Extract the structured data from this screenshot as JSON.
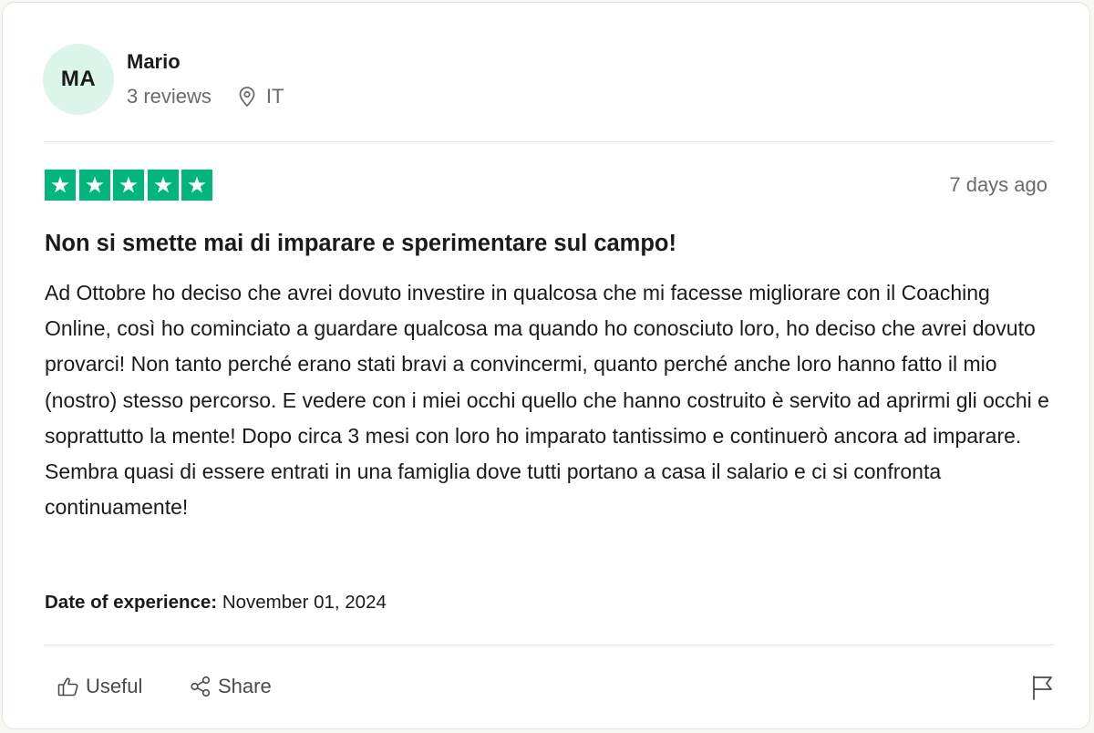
{
  "reviewer": {
    "initials": "MA",
    "name": "Mario",
    "review_count": "3 reviews",
    "country": "IT"
  },
  "review": {
    "rating": 5,
    "max_rating": 5,
    "posted": "7 days ago",
    "title": "Non si smette mai di imparare e sperimentare sul campo!",
    "body": "Ad Ottobre ho deciso che avrei dovuto investire in qualcosa che mi facesse migliorare con il Coaching Online, così ho cominciato a guardare qualcosa ma quando ho conosciuto loro, ho deciso che avrei dovuto provarci! Non tanto perché erano stati bravi a convincermi, quanto perché anche loro hanno fatto il mio (nostro) stesso percorso. E vedere con i miei occhi quello che hanno costruito è servito ad aprirmi gli occhi e soprattutto la mente! Dopo circa 3 mesi con loro ho imparato tantissimo e continuerò ancora ad imparare. Sembra quasi di essere entrati in una famiglia dove tutti portano a casa il salario e ci si confronta continuamente!",
    "experience_label": "Date of experience:",
    "experience_date": "November 01, 2024"
  },
  "actions": {
    "useful_label": "Useful",
    "share_label": "Share"
  },
  "icons": {
    "location": "location-pin-icon",
    "star": "star-icon",
    "useful": "thumbs-up-icon",
    "share": "share-icon",
    "flag": "flag-icon"
  },
  "colors": {
    "star_green": "#00b67a",
    "avatar_bg": "#dcf5ea",
    "muted_text": "#6b6b6b"
  }
}
